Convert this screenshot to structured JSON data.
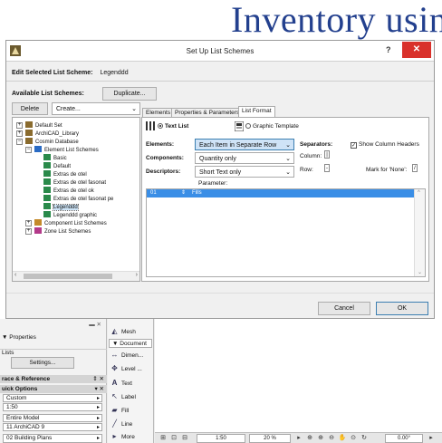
{
  "banner": {
    "text": "Inventory using"
  },
  "dialog": {
    "title": "Set Up List Schemes",
    "help": "?",
    "close": "✕",
    "edit_label": "Edit Selected List Scheme:",
    "edit_value": "Legenddd",
    "available_label": "Available List Schemes:",
    "duplicate_btn": "Duplicate...",
    "delete_btn": "Delete",
    "create_select": "Create...",
    "tree": [
      {
        "label": "Default Set",
        "exp": "+"
      },
      {
        "label": "ArchiCAD_Library",
        "exp": "+"
      },
      {
        "label": "Cosmin Database",
        "exp": "−"
      },
      {
        "label": "Element List Schemes",
        "exp": "−"
      },
      {
        "label": "Basic"
      },
      {
        "label": "Default"
      },
      {
        "label": "Extras de otel"
      },
      {
        "label": "Extras de otel fasonat"
      },
      {
        "label": "Extras de otel ok"
      },
      {
        "label": "Extras de otel fasonat pe"
      },
      {
        "label": "Legenddd",
        "selected": true
      },
      {
        "label": "Legenddd graphic"
      },
      {
        "label": "Component List Schemes",
        "exp": "+"
      },
      {
        "label": "Zone List Schemes",
        "exp": "+"
      }
    ],
    "tabs": [
      "Elements",
      "Properties & Parameters",
      "List Format"
    ],
    "text_list": "Text List",
    "graphic_template": "Graphic Template",
    "elements_label": "Elements:",
    "elements_value": "Each Item in Separate Row",
    "components_label": "Components:",
    "components_value": "Quantity only",
    "descriptors_label": "Descriptors:",
    "descriptors_value": "Short Text only",
    "separators_label": "Separators:",
    "show_col_headers": "Show Column Headers",
    "column_label": "Column:",
    "column_value": "|",
    "row_label": "Row:",
    "row_value": "-",
    "mark_none_label": "Mark for 'None':",
    "mark_none_value": "/",
    "parameter_header": "Parameter:",
    "param_row_num": "01",
    "param_row_name": "Fills",
    "cancel_btn": "Cancel",
    "ok_btn": "OK"
  },
  "lower": {
    "properties": "Properties",
    "lists": "Lists",
    "settings_btn": "Settings...",
    "trace_ref": "race & Reference",
    "quick_options": "uick Options",
    "sel1": "Custom",
    "sel2": "1:50",
    "sel3": "Entire Model",
    "sel4": "11 ArchiCAD 9",
    "sel5": "02 Building Plans",
    "tools": [
      "Mesh",
      "Document",
      "Dimen...",
      "Level ...",
      "Text",
      "Label",
      "Fill",
      "Line",
      "More"
    ],
    "status": {
      "scale": "1:50",
      "zoom": "20 %",
      "angle": "0.00°"
    }
  }
}
